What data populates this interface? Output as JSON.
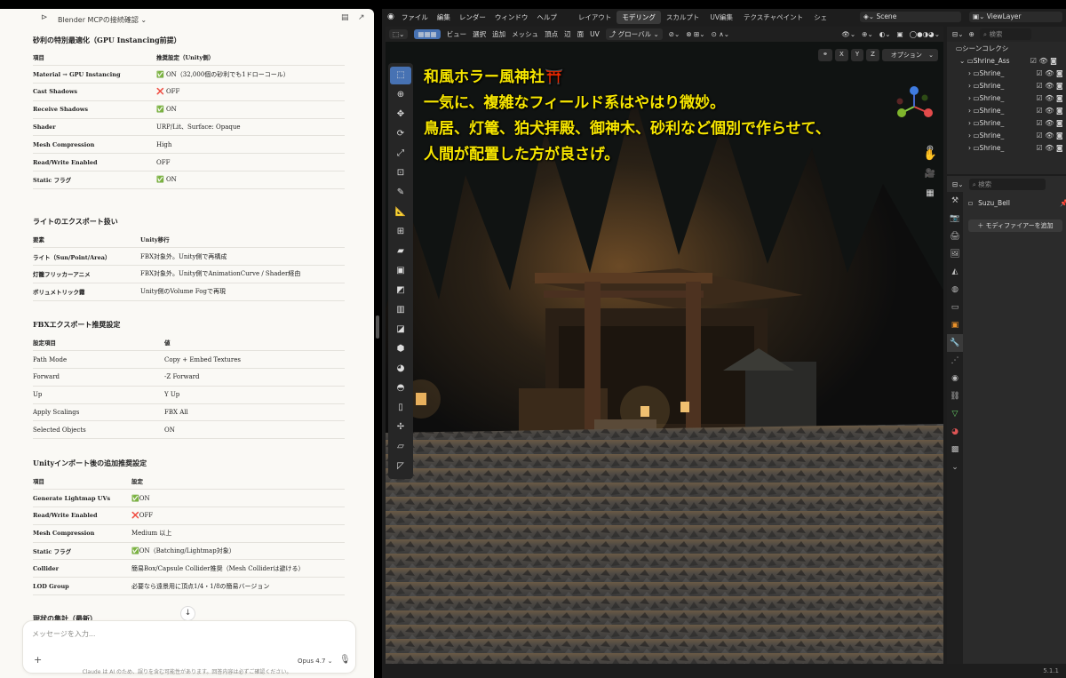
{
  "chat": {
    "title": "Blender MCPの接続確認",
    "sections": [
      {
        "title": "砂利の特別最適化（GPU Instancing前提）",
        "headers": [
          "項目",
          "推奨設定（Unity側）"
        ],
        "rows": [
          [
            "Material → GPU Instancing",
            "✅ ON（32,000個の砂利でも1ドローコール）"
          ],
          [
            "Cast Shadows",
            "❌ OFF"
          ],
          [
            "Receive Shadows",
            "✅ ON"
          ],
          [
            "Shader",
            "URP/Lit、Surface: Opaque"
          ],
          [
            "Mesh Compression",
            "High"
          ],
          [
            "Read/Write Enabled",
            "OFF"
          ],
          [
            "Static フラグ",
            "✅ ON"
          ]
        ]
      },
      {
        "title": "ライトのエクスポート扱い",
        "headers": [
          "要素",
          "Unity移行"
        ],
        "rows": [
          [
            "ライト（Sun/Point/Area）",
            "FBX対象外。Unity側で再構成"
          ],
          [
            "灯籠フリッカーアニメ",
            "FBX対象外。Unity側でAnimationCurve / Shader経由"
          ],
          [
            "ボリュメトリック霧",
            "Unity側のVolume Fogで再現"
          ]
        ]
      },
      {
        "title": "FBXエクスポート推奨設定",
        "headers": [
          "設定項目",
          "値"
        ],
        "rows": [
          [
            "Path Mode",
            "Copy + Embed Textures"
          ],
          [
            "Forward",
            "-Z Forward"
          ],
          [
            "Up",
            "Y Up"
          ],
          [
            "Apply Scalings",
            "FBX All"
          ],
          [
            "Selected Objects",
            "ON"
          ]
        ]
      },
      {
        "title": "Unityインポート後の追加推奨設定",
        "headers": [
          "項目",
          "設定"
        ],
        "rows": [
          [
            "Generate Lightmap UVs",
            "✅ON"
          ],
          [
            "Read/Write Enabled",
            "❌OFF"
          ],
          [
            "Mesh Compression",
            "Medium 以上"
          ],
          [
            "Static フラグ",
            "✅ON（Batching/Lightmap対象）"
          ],
          [
            "Collider",
            "簡易Box/Capsule Collider推奨（Mesh Colliderは避ける）"
          ],
          [
            "LOD Group",
            "必要なら遠景用に頂点1/4・1/8の簡易バージョン"
          ]
        ]
      },
      {
        "title": "現状の集計（最新）",
        "headers": [],
        "rows": []
      }
    ],
    "input_placeholder": "メッセージを入力...",
    "model": "Opus 4.7 ⌄",
    "disclaimer": "Claude は AI のため、誤りを含む可能性があります。回答内容は必ずご確認ください。"
  },
  "blender": {
    "menu": [
      "ファイル",
      "編集",
      "レンダー",
      "ウィンドウ",
      "ヘルプ"
    ],
    "workspaces": [
      "レイアウト",
      "モデリング",
      "スカルプト",
      "UV編集",
      "テクスチャペイント",
      "シェ"
    ],
    "active_workspace": "モデリング",
    "scene": "Scene",
    "view_layer": "ViewLayer",
    "viewport_menu": [
      "ビュー",
      "選択",
      "追加",
      "メッシュ",
      "頂点",
      "辺",
      "面",
      "UV"
    ],
    "transform_orientation": "グローバル",
    "options": "オプション",
    "axes": [
      "X",
      "Y",
      "Z"
    ],
    "overlay_lines": [
      "和風ホラー風神社⛩️",
      "一気に、複雑なフィールド系はやはり微妙。",
      "鳥居、灯篭、狛犬拝殿、御神木、砂利など個別で作らせて、",
      "人間が配置した方が良さげ。"
    ],
    "outliner": {
      "search_placeholder": "検索",
      "collection": "シーンコレクシ",
      "items": [
        "Shrine_Ass",
        "Shrine_",
        "Shrine_",
        "Shrine_",
        "Shrine_",
        "Shrine_",
        "Shrine_",
        "Shrine_"
      ]
    },
    "properties": {
      "search_placeholder": "検索",
      "object": "Suzu_Bell",
      "add_modifier": "＋ モディファイアーを追加"
    },
    "version": "5.1.1",
    "accent": "#4772b3",
    "overlay_color": "#f7e600"
  }
}
